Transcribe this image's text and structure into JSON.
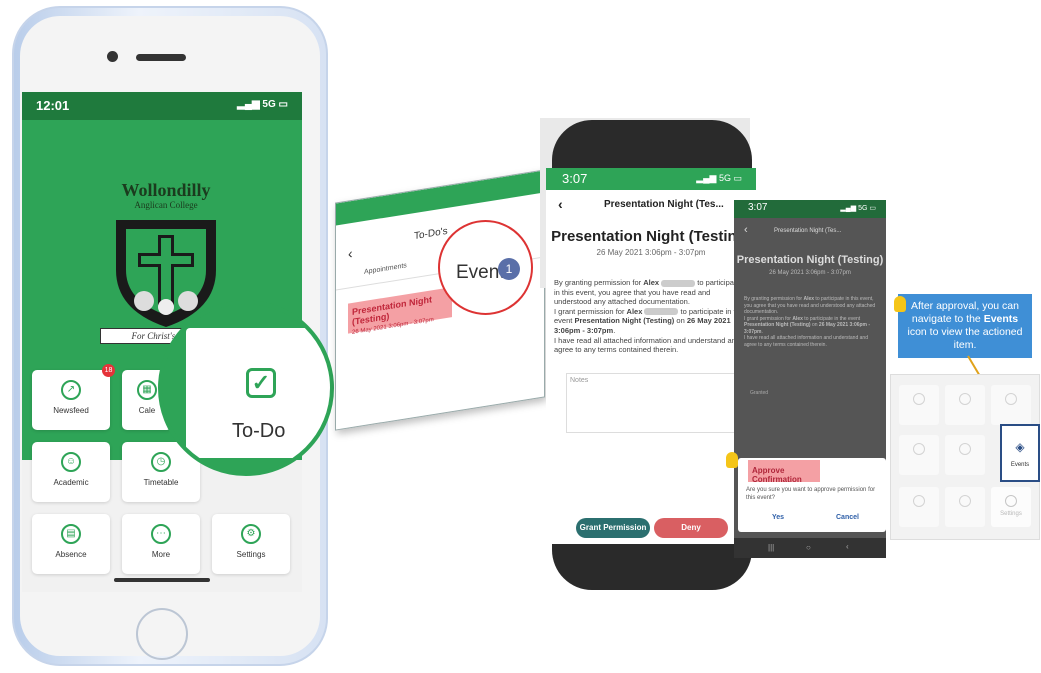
{
  "phone1": {
    "time": "12:01",
    "signal": "5G",
    "school_name": "Wollondilly",
    "school_sub": "Anglican College",
    "motto": "For Christ's Glory",
    "tiles": [
      {
        "label": "Newsfeed",
        "badge": "18"
      },
      {
        "label": "Cale"
      },
      {
        "label": "Academic"
      },
      {
        "label": "Timetable"
      },
      {
        "label": "Absence"
      },
      {
        "label": "More"
      },
      {
        "label": "Settings"
      }
    ],
    "zoom_label": "To-Do"
  },
  "todo_screen": {
    "title": "To-Do's",
    "tab_appointments": "Appointments",
    "events_label": "Events",
    "events_count": "1",
    "item_title": "Presentation Night (Testing)",
    "item_date": "26 May 2021 3:06pm - 3:07pm"
  },
  "phone2": {
    "time": "3:07",
    "signal": "5G",
    "header": "Presentation Night (Tes...",
    "title": "Presentation Night (Testing)",
    "date": "26 May 2021 3:06pm - 3:07pm",
    "body1": "By granting permission for ",
    "name": "Alex",
    "body2": " to participate in this event, you agree that you have read and understood any attached documentation.",
    "body3": "I grant permission for ",
    "body4": " to participate in the event ",
    "event_name": "Presentation Night (Testing)",
    "body5": " on ",
    "event_date": "26 May 2021 3:06pm - 3:07pm",
    "body6": ".",
    "body7": "I have read all attached information and understand and agree to any terms contained therein.",
    "notes_placeholder": "Notes",
    "grant_label": "Grant Permission",
    "deny_label": "Deny"
  },
  "phone3": {
    "time": "3:07",
    "signal": "5G",
    "header": "Presentation Night (Tes...",
    "title": "Presentation Night (Testing)",
    "date": "26 May 2021 3:06pm - 3:07pm",
    "granted": "Granted"
  },
  "dialog": {
    "title": "Approve Confirmation",
    "body": "Are you sure you want to approve permission for this event?",
    "yes": "Yes",
    "cancel": "Cancel"
  },
  "callout": {
    "text1": "After approval, you can navigate to the ",
    "bold": "Events",
    "text2": " icon to view the actioned item."
  },
  "grid": {
    "events_label": "Events",
    "settings_label": "Settings"
  },
  "colors": {
    "green": "#2ea457",
    "teal": "#2b6f6f",
    "red": "#d95f62",
    "blue": "#3f8fd6"
  }
}
